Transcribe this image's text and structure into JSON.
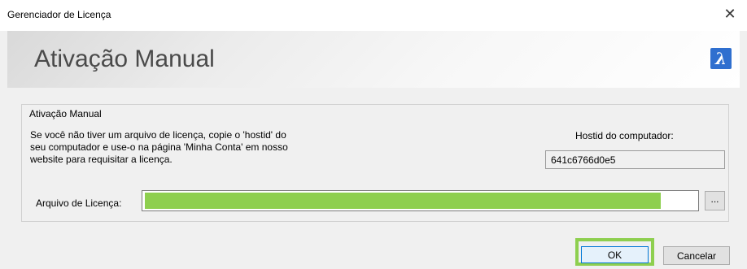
{
  "window": {
    "title": "Gerenciador de Licença",
    "close_icon": "close-icon"
  },
  "header": {
    "title": "Ativação Manual",
    "logo": {
      "icon": "bricscad-logo-icon",
      "glyph": "λ",
      "color": "#2f6fcf"
    }
  },
  "group": {
    "legend": "Ativação Manual",
    "description": [
      "Se você não tiver um arquivo de licença, copie o 'hostid' do",
      "seu computador e use-o na página 'Minha Conta' em nosso",
      "website para requisitar a licença."
    ],
    "hostid_label": "Hostid do computador:",
    "hostid_value": "641c6766d0e5",
    "file_label": "Arquivo de Licença:",
    "file_value": "",
    "browse_label": "..."
  },
  "buttons": {
    "ok": "OK",
    "cancel": "Cancelar"
  },
  "colors": {
    "highlight": "#8ecf4f",
    "ok_border": "#0078d7"
  }
}
